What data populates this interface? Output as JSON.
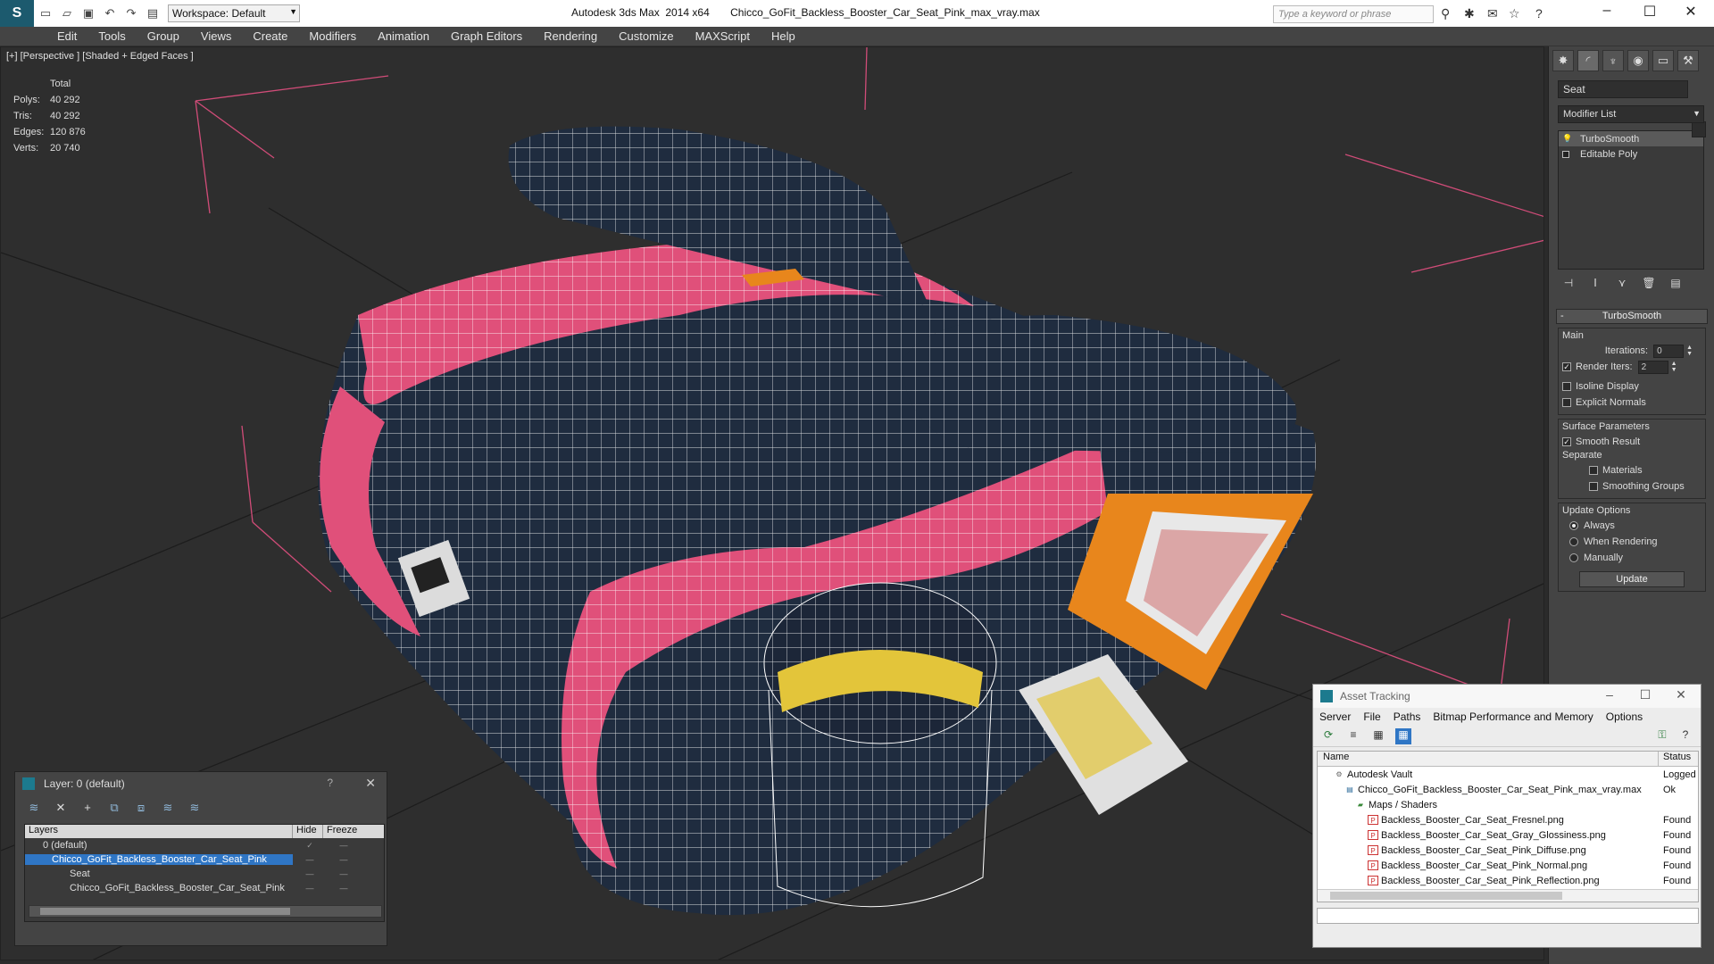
{
  "titlebar": {
    "workspace": "Workspace: Default",
    "title": "Autodesk 3ds Max  2014 x64       Chicco_GoFit_Backless_Booster_Car_Seat_Pink_max_vray.max",
    "search_placeholder": "Type a keyword or phrase"
  },
  "menu": [
    "Edit",
    "Tools",
    "Group",
    "Views",
    "Create",
    "Modifiers",
    "Animation",
    "Graph Editors",
    "Rendering",
    "Customize",
    "MAXScript",
    "Help"
  ],
  "viewport": {
    "label": "[+] [Perspective ] [Shaded + Edged Faces ]",
    "stats": {
      "header": "Total",
      "polys_label": "Polys:",
      "polys": "40 292",
      "tris_label": "Tris:",
      "tris": "40 292",
      "edges_label": "Edges:",
      "edges": "120 876",
      "verts_label": "Verts:",
      "verts": "20 740"
    }
  },
  "command_panel": {
    "object_name": "Seat",
    "modifier_list": "Modifier List",
    "stack": [
      "TurboSmooth",
      "Editable Poly"
    ],
    "rollout_title": "TurboSmooth",
    "main_group": "Main",
    "iterations_label": "Iterations:",
    "iterations": "0",
    "render_iters_label": "Render Iters:",
    "render_iters": "2",
    "isoline_label": "Isoline Display",
    "explicit_label": "Explicit Normals",
    "surface_group": "Surface Parameters",
    "smooth_result_label": "Smooth Result",
    "separate_label": "Separate",
    "materials_label": "Materials",
    "smoothing_groups_label": "Smoothing Groups",
    "update_group": "Update Options",
    "always_label": "Always",
    "when_rendering_label": "When Rendering",
    "manually_label": "Manually",
    "update_button": "Update"
  },
  "layer_dialog": {
    "title": "Layer: 0 (default)",
    "help": "?",
    "col_layers": "Layers",
    "col_hide": "Hide",
    "col_freeze": "Freeze",
    "rows": [
      "0 (default)",
      "Chicco_GoFit_Backless_Booster_Car_Seat_Pink",
      "Seat",
      "Chicco_GoFit_Backless_Booster_Car_Seat_Pink"
    ]
  },
  "asset_dialog": {
    "title": "Asset Tracking",
    "menu": [
      "Server",
      "File",
      "Paths",
      "Bitmap Performance and Memory",
      "Options"
    ],
    "col_name": "Name",
    "col_status": "Status",
    "rows": [
      {
        "name": "Autodesk Vault",
        "status": "Logged"
      },
      {
        "name": "Chicco_GoFit_Backless_Booster_Car_Seat_Pink_max_vray.max",
        "status": "Ok"
      },
      {
        "name": "Maps / Shaders",
        "status": ""
      },
      {
        "name": "Backless_Booster_Car_Seat_Fresnel.png",
        "status": "Found"
      },
      {
        "name": "Backless_Booster_Car_Seat_Gray_Glossiness.png",
        "status": "Found"
      },
      {
        "name": "Backless_Booster_Car_Seat_Pink_Diffuse.png",
        "status": "Found"
      },
      {
        "name": "Backless_Booster_Car_Seat_Pink_Normal.png",
        "status": "Found"
      },
      {
        "name": "Backless_Booster_Car_Seat_Pink_Reflection.png",
        "status": "Found"
      }
    ]
  },
  "colors": {
    "stats": "#e8d36a",
    "selection": "#2f76c5",
    "seat_pink": "#e0507a",
    "seat_navy": "#1f2c3f",
    "seat_orange": "#e8861c"
  }
}
